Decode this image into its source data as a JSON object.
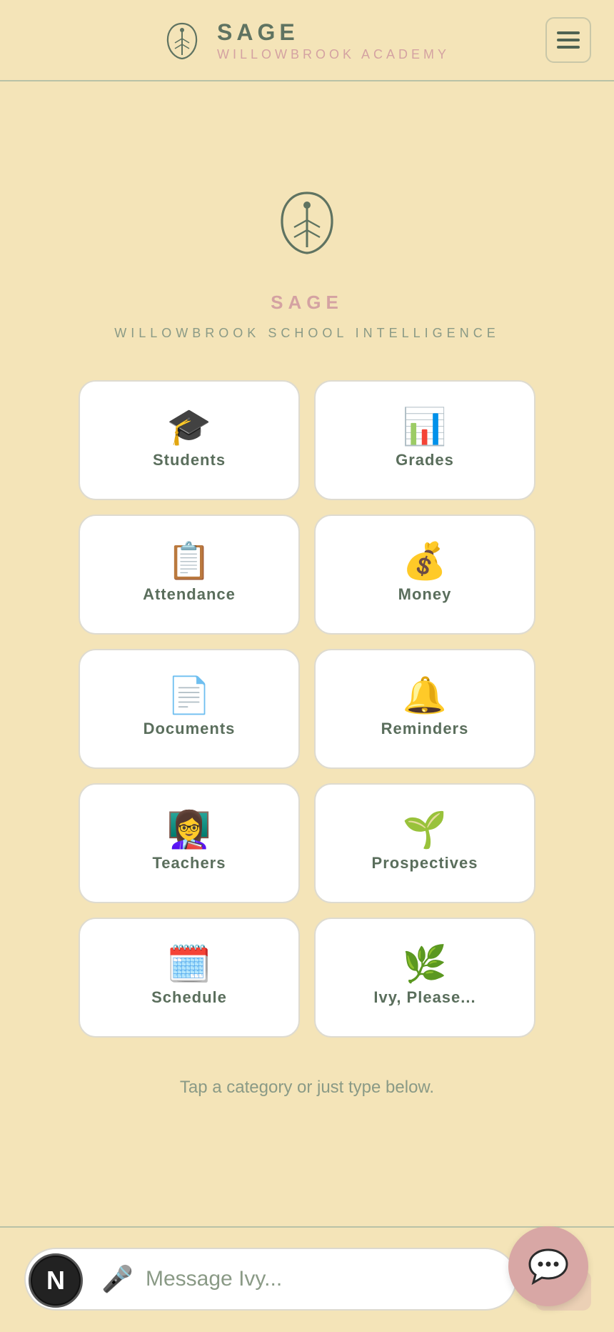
{
  "header": {
    "title": "SAGE",
    "subtitle": "WILLOWBROOK ACADEMY",
    "menu_icon": "hamburger-menu-icon"
  },
  "hero": {
    "title": "SAGE",
    "subtitle": "WILLOWBROOK SCHOOL INTELLIGENCE",
    "logo_icon": "leaf-icon"
  },
  "categories": [
    {
      "label": "Students",
      "icon": "🎓",
      "icon_name": "graduation-cap-icon"
    },
    {
      "label": "Grades",
      "icon": "📊",
      "icon_name": "bar-chart-icon"
    },
    {
      "label": "Attendance",
      "icon": "📋",
      "icon_name": "clipboard-icon"
    },
    {
      "label": "Money",
      "icon": "💰",
      "icon_name": "money-bag-icon"
    },
    {
      "label": "Documents",
      "icon": "📄",
      "icon_name": "document-icon"
    },
    {
      "label": "Reminders",
      "icon": "🔔",
      "icon_name": "bell-icon"
    },
    {
      "label": "Teachers",
      "icon": "👩‍🏫",
      "icon_name": "teacher-icon"
    },
    {
      "label": "Prospectives",
      "icon": "🌱",
      "icon_name": "seedling-icon"
    },
    {
      "label": "Schedule",
      "icon": "🗓️",
      "icon_name": "calendar-icon"
    },
    {
      "label": "Ivy, Please...",
      "icon": "🌿",
      "icon_name": "herb-icon"
    }
  ],
  "hint": "Tap a category or just type below.",
  "composer": {
    "avatar_letter": "N",
    "mic_icon": "🎤",
    "placeholder": "Message Ivy..."
  },
  "colors": {
    "background": "#f4e4b8",
    "accent_green": "#5a6e5c",
    "accent_pink": "#d4a2a2",
    "fab": "#d8a7a5"
  }
}
